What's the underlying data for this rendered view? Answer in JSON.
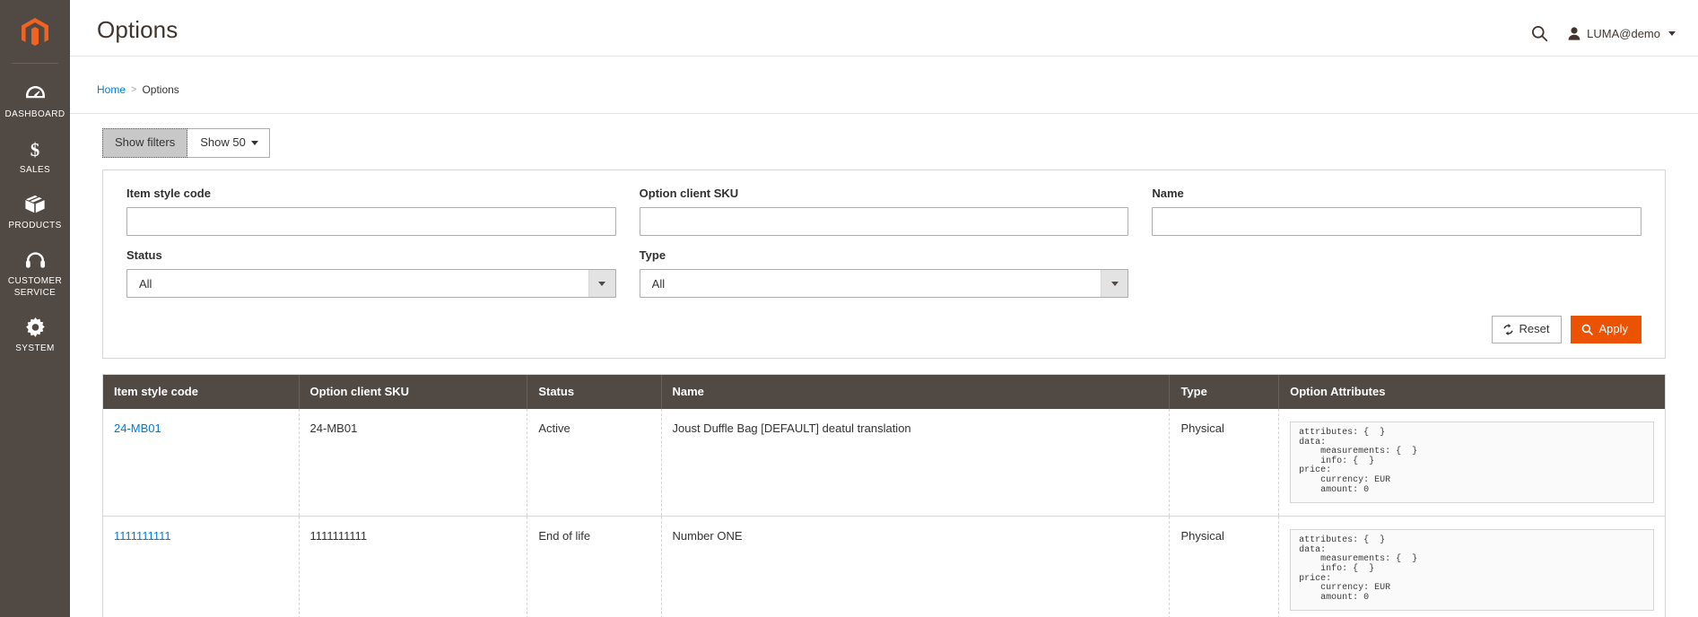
{
  "sidebar": {
    "logo_icon": "magento-logo-icon",
    "items": [
      {
        "label": "Dashboard",
        "icon": "dashboard-gauge-icon"
      },
      {
        "label": "Sales",
        "icon": "dollar-sign-icon"
      },
      {
        "label": "Products",
        "icon": "box-icon"
      },
      {
        "label": "Customer Service",
        "icon": "headset-icon"
      },
      {
        "label": "System",
        "icon": "gear-icon"
      }
    ]
  },
  "header": {
    "title": "Options",
    "search_icon": "search-icon",
    "user_icon": "user-avatar-icon",
    "user_name": "LUMA@demo",
    "caret_icon": "chevron-down-icon"
  },
  "breadcrumb": {
    "home": "Home",
    "separator": ">",
    "current": "Options"
  },
  "toolbar": {
    "show_filters_label": "Show filters",
    "show_count_label": "Show 50",
    "show_count_caret": "chevron-down-icon"
  },
  "filters": {
    "item_style_code": {
      "label": "Item style code",
      "value": "",
      "placeholder": ""
    },
    "option_client_sku": {
      "label": "Option client SKU",
      "value": "",
      "placeholder": ""
    },
    "name": {
      "label": "Name",
      "value": "",
      "placeholder": ""
    },
    "status": {
      "label": "Status",
      "value": "All",
      "options": [
        "All"
      ]
    },
    "type": {
      "label": "Type",
      "value": "All",
      "options": [
        "All"
      ]
    },
    "reset_label": "Reset",
    "reset_icon": "refresh-icon",
    "apply_label": "Apply",
    "apply_icon": "search-icon"
  },
  "grid": {
    "columns": [
      "Item style code",
      "Option client SKU",
      "Status",
      "Name",
      "Type",
      "Option Attributes"
    ],
    "rows": [
      {
        "item_style_code": "24-MB01",
        "option_client_sku": "24-MB01",
        "status": "Active",
        "name": "Joust Duffle Bag [DEFAULT] deatul translation",
        "type": "Physical",
        "option_attributes": "attributes: {  }\ndata:\n    measurements: {  }\n    info: {  }\nprice:\n    currency: EUR\n    amount: 0"
      },
      {
        "item_style_code": "1111111111",
        "option_client_sku": "1111111111",
        "status": "End of life",
        "name": "Number ONE",
        "type": "Physical",
        "option_attributes": "attributes: {  }\ndata:\n    measurements: {  }\n    info: {  }\nprice:\n    currency: EUR\n    amount: 0"
      }
    ]
  },
  "colors": {
    "brand_orange": "#eb5202",
    "sidebar_bg": "#514943",
    "link_blue": "#007bdb",
    "grid_header_bg": "#514943"
  }
}
